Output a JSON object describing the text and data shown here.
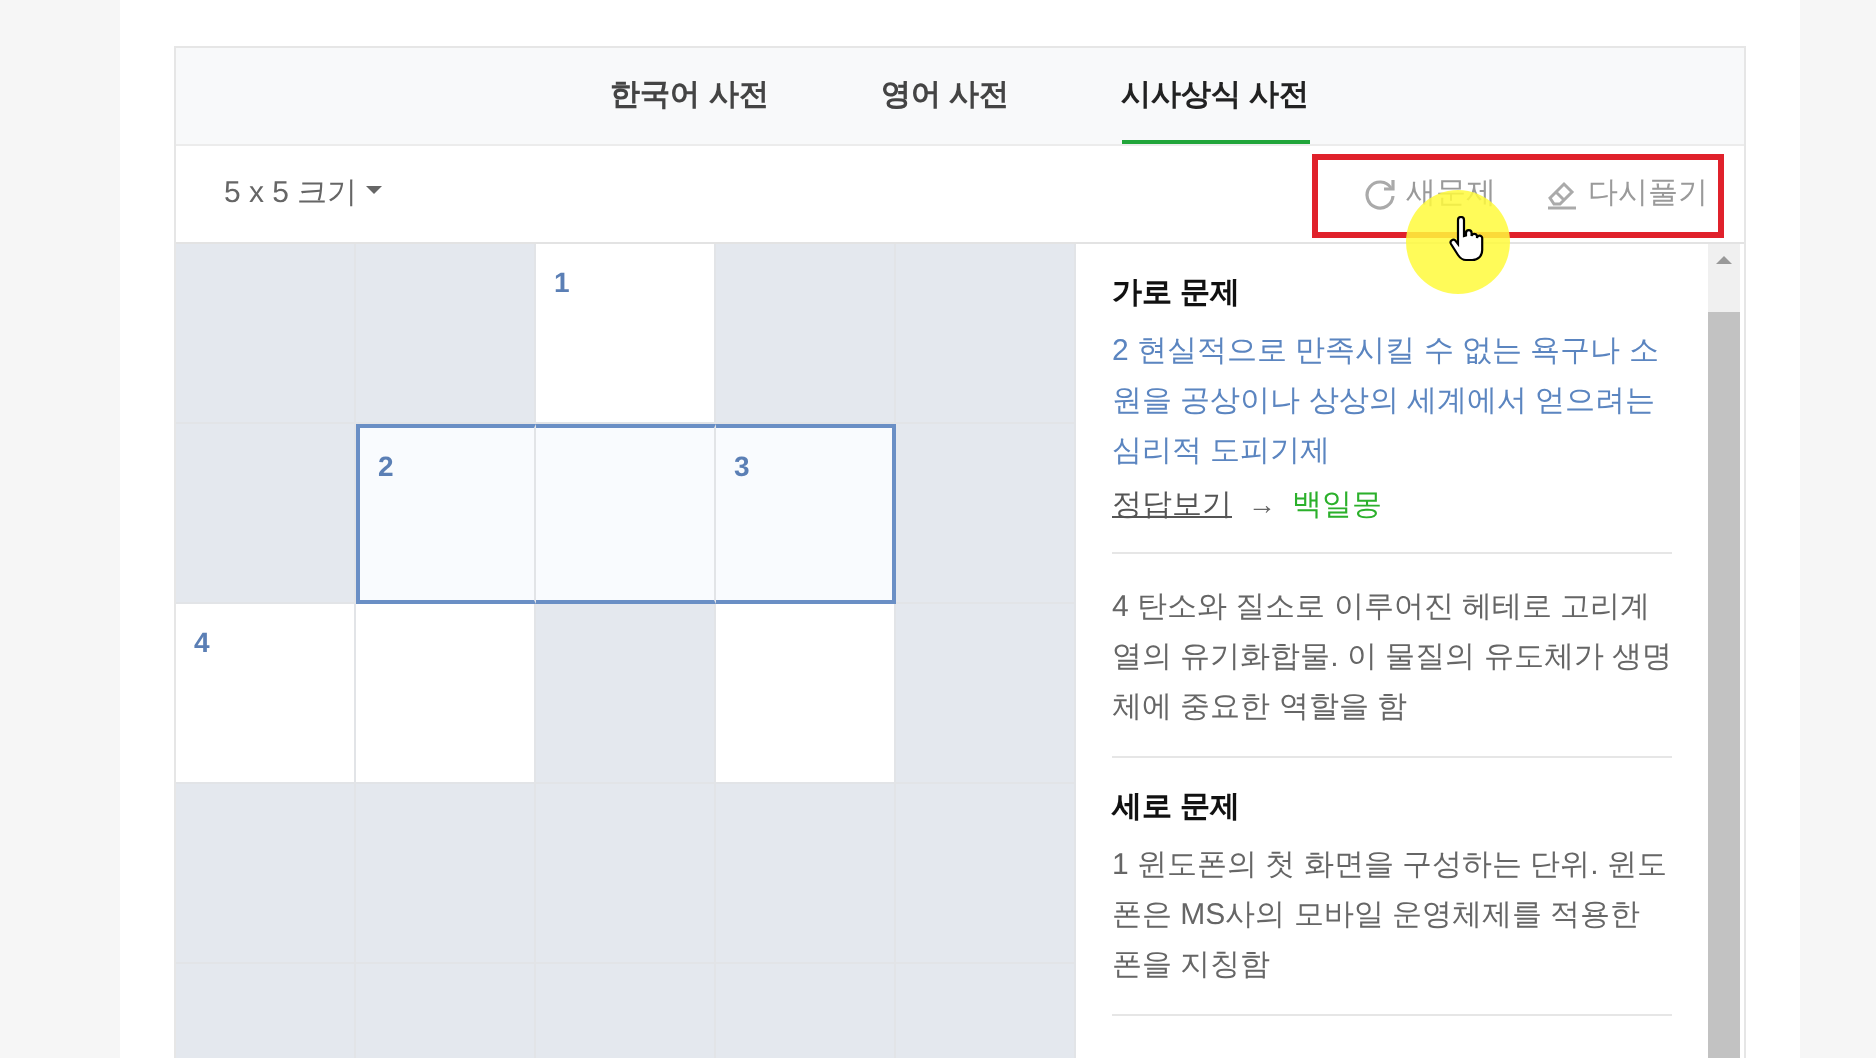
{
  "tabs": [
    {
      "label": "한국어 사전",
      "selected": false
    },
    {
      "label": "영어 사전",
      "selected": false
    },
    {
      "label": "시사상식 사전",
      "selected": true
    }
  ],
  "size_menu": {
    "label": "5 x 5 크기"
  },
  "toolbar_buttons": [
    {
      "kind": "refresh",
      "label": "새문제"
    },
    {
      "kind": "eraser",
      "label": "다시풀기"
    }
  ],
  "grid": {
    "rows": [
      [
        {
          "open": false,
          "highlighted": false
        },
        {
          "open": false,
          "highlighted": false
        },
        {
          "open": true,
          "number": "1",
          "highlighted": false
        },
        {
          "open": false,
          "highlighted": false
        },
        {
          "open": false,
          "highlighted": false
        }
      ],
      [
        {
          "open": false,
          "highlighted": false
        },
        {
          "open": true,
          "number": "2",
          "highlighted": true
        },
        {
          "open": true,
          "highlighted": true
        },
        {
          "open": true,
          "number": "3",
          "highlighted": true
        },
        {
          "open": false,
          "highlighted": false
        }
      ],
      [
        {
          "open": true,
          "number": "4",
          "highlighted": false
        },
        {
          "open": true,
          "highlighted": false
        },
        {
          "open": false,
          "highlighted": false
        },
        {
          "open": true,
          "highlighted": false
        },
        {
          "open": false,
          "highlighted": false
        }
      ],
      [
        {
          "open": false,
          "highlighted": false
        },
        {
          "open": false,
          "highlighted": false
        },
        {
          "open": false,
          "highlighted": false
        },
        {
          "open": false,
          "highlighted": false
        },
        {
          "open": false,
          "highlighted": false
        }
      ],
      [
        {
          "open": false,
          "highlighted": false
        },
        {
          "open": false,
          "highlighted": false
        },
        {
          "open": false,
          "highlighted": false
        },
        {
          "open": false,
          "highlighted": false
        },
        {
          "open": false,
          "highlighted": false
        }
      ]
    ]
  },
  "clue_sections": [
    {
      "heading": "가로 문제",
      "clues": [
        {
          "text": "2 현실적으로 만족시킬 수 없는 욕구나 소원을 공상이나 상상의 세계에서 얻으려는 심리적 도피기제",
          "selected": true,
          "answer_link": "정답보기",
          "arrow": "→",
          "answer": "백일몽"
        },
        {
          "text": "4 탄소와 질소로 이루어진 헤테로 고리계열의 유기화합물. 이 물질의 유도체가 생명체에 중요한 역할을 함",
          "selected": false
        }
      ]
    },
    {
      "heading": "세로 문제",
      "clues": [
        {
          "text": "1 윈도폰의 첫 화면을 구성하는 단위. 윈도폰은 MS사의 모바일 운영체제를 적용한 폰을 지칭함",
          "selected": false
        }
      ]
    }
  ]
}
